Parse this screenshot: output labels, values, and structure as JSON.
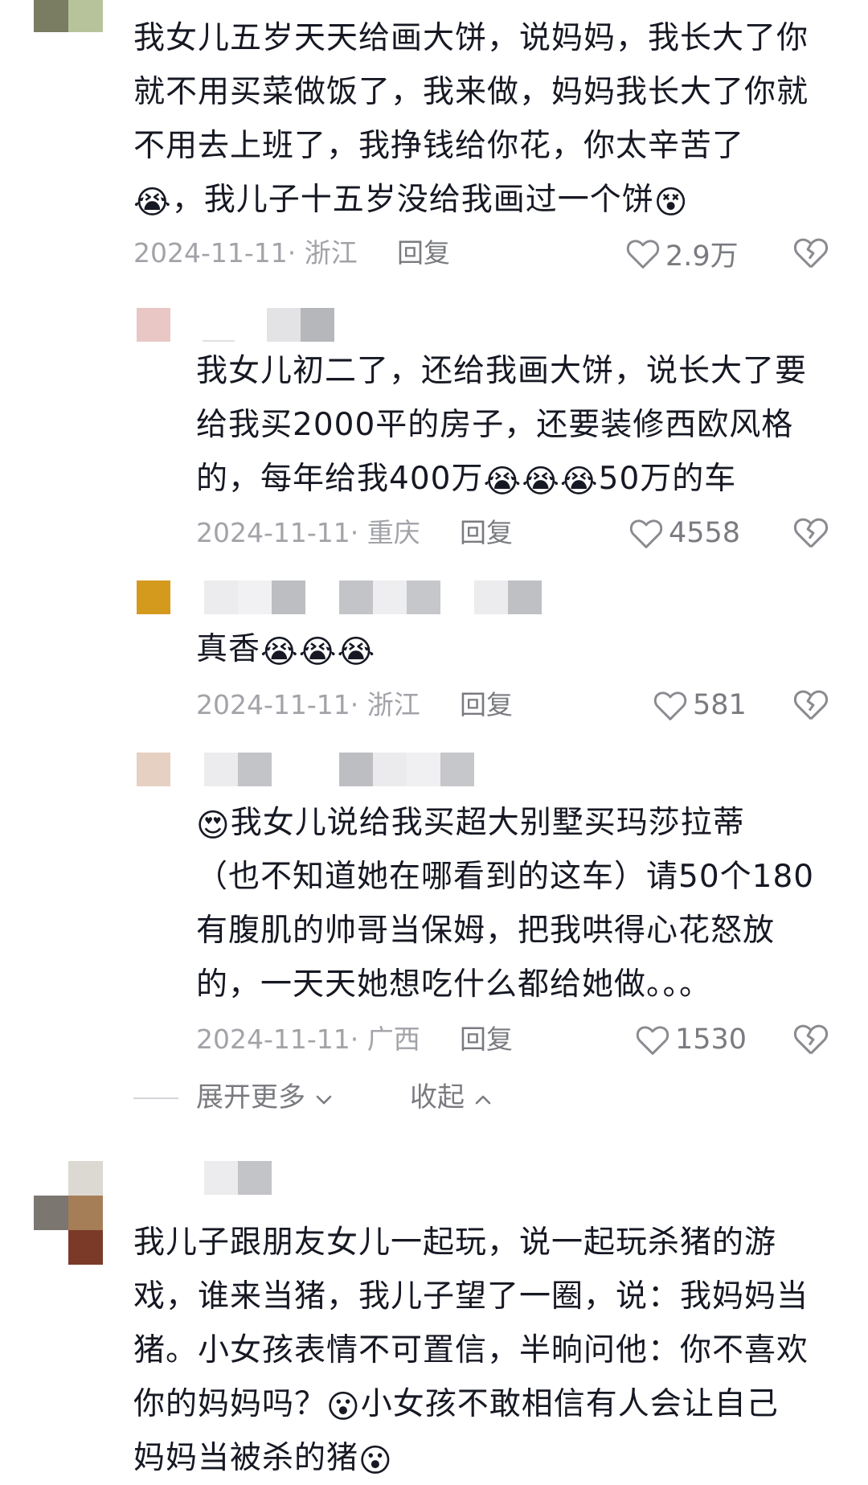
{
  "comments": [
    {
      "text_a": "我女儿五岁天天给画大饼，说妈妈，我长大了你\n就不用买菜做饭了，我来做，妈妈我长大了你就\n不用去上班了，我挣钱给你花，你太辛苦了\n",
      "emoji_a": "😭",
      "text_b": "，我儿子十五岁没给我画过一个饼",
      "emoji_b": "😵",
      "date_loc": "2024-11-11· 浙江",
      "reply": "回复",
      "likes": "2.9万"
    },
    {
      "text_a": "我女儿初二了，还给我画大饼，说长大了要\n给我买2000平的房子，还要装修西欧风格\n的，每年给我400万",
      "emoji_a": "😭😭😭",
      "text_b": "50万的车",
      "date_loc": "2024-11-11· 重庆",
      "reply": "回复",
      "likes": "4558"
    },
    {
      "text_a": "真香",
      "emoji_a": "😭😭😭",
      "date_loc": "2024-11-11· 浙江",
      "reply": "回复",
      "likes": "581"
    },
    {
      "emoji_a": "😍",
      "text_a": "我女儿说给我买超大别墅买玛莎拉蒂\n（也不知道她在哪看到的这车）请50个180\n有腹肌的帅哥当保姆，把我哄得心花怒放\n的，一天天她想吃什么都给她做。。。",
      "date_loc": "2024-11-11· 广西",
      "reply": "回复",
      "likes": "1530"
    },
    {
      "text_a": "我儿子跟朋友女儿一起玩，说一起玩杀猪的游\n戏，谁来当猪，我儿子望了一圈，说：我妈妈当\n猪。小女孩表情不可置信，半晌问他：你不喜欢\n你的妈妈吗？",
      "emoji_a": "😮",
      "text_b": "小女孩不敢相信有人会让自己\n妈妈当被杀的猪",
      "emoji_b": "😮"
    }
  ],
  "expand": {
    "more": "展开更多",
    "collapse": "收起"
  },
  "icons": {
    "like": "heart-outline-icon",
    "dislike": "broken-heart-icon",
    "expand": "chevron-down-icon",
    "collapse": "chevron-up-icon"
  },
  "colors": {
    "meta": "#a2a3a8",
    "text": "#161823",
    "action": "#7a7b80"
  }
}
